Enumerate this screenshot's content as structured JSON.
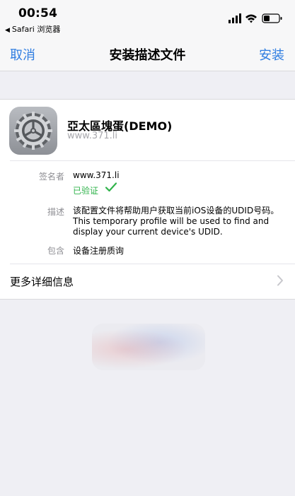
{
  "status_bar": {
    "time": "00:54",
    "back_app": "Safari 浏览器"
  },
  "nav": {
    "cancel": "取消",
    "title": "安装描述文件",
    "install": "安装"
  },
  "profile": {
    "name": "亞太區塊蛋(DEMO)",
    "subtitle": "www.371.li"
  },
  "details": {
    "signer_label": "签名者",
    "signer_value": "www.371.li",
    "verified_text": "已验证",
    "description_label": "描述",
    "description_lines": [
      "该配置文件将帮助用户获取当前iOS设备的UDID号码。",
      "This temporary profile will be used to find and",
      "display your current device's UDID."
    ],
    "contains_label": "包含",
    "contains_value": "设备注册质询"
  },
  "more_details": "更多详细信息",
  "colors": {
    "accent": "#2f7de1",
    "verified": "#30b34b",
    "secondary_text": "#8e8e93",
    "background": "#efeff4"
  }
}
